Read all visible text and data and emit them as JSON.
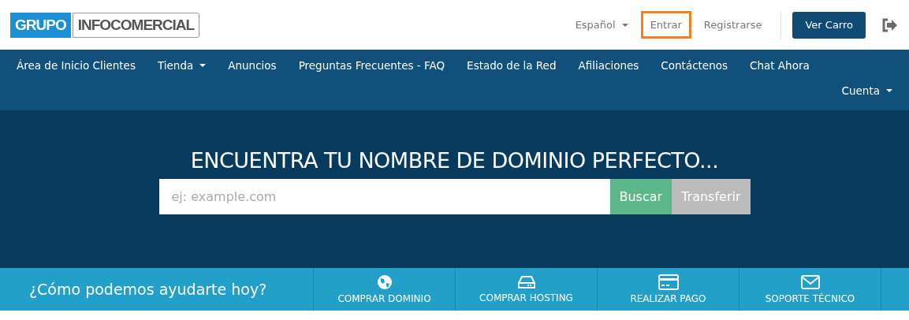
{
  "logo": {
    "part_1": "GRUPO",
    "part_2": "INFOCOMERCIAL"
  },
  "top_links": [
    {
      "label": "Español",
      "kind": "dropdown",
      "highlighted": false
    },
    {
      "label": "Entrar",
      "kind": "link",
      "highlighted": true
    },
    {
      "label": "Registrarse",
      "kind": "link",
      "highlighted": false
    }
  ],
  "cart_button": "Ver Carro",
  "nav": [
    {
      "label": "Área de Inicio Clientes",
      "dropdown": false
    },
    {
      "label": "Tienda",
      "dropdown": true
    },
    {
      "label": "Anuncios",
      "dropdown": false
    },
    {
      "label": "Preguntas Frecuentes - FAQ",
      "dropdown": false
    },
    {
      "label": "Estado de la Red",
      "dropdown": false
    },
    {
      "label": "Afiliaciones",
      "dropdown": false
    },
    {
      "label": "Contáctenos",
      "dropdown": false
    },
    {
      "label": "Chat Ahora",
      "dropdown": false
    }
  ],
  "nav_right": [
    {
      "label": "Cuenta",
      "dropdown": true
    }
  ],
  "hero": {
    "title": "ENCUENTRA TU NOMBRE DE DOMINIO PERFECTO...",
    "placeholder": "ej: example.com",
    "buttons": [
      {
        "label": "Buscar",
        "kind": "primary"
      },
      {
        "label": "Transferir",
        "kind": "secondary"
      }
    ]
  },
  "help": {
    "title": "¿Cómo podemos ayudarte hoy?",
    "actions": [
      {
        "label": "COMPRAR DOMINIO",
        "kind": "globe"
      },
      {
        "label": "COMPRAR HOSTING",
        "kind": "drive"
      },
      {
        "label": "REALIZAR PAGO",
        "kind": "card"
      },
      {
        "label": "SOPORTE TÉCNICO",
        "kind": "mail"
      }
    ]
  }
}
